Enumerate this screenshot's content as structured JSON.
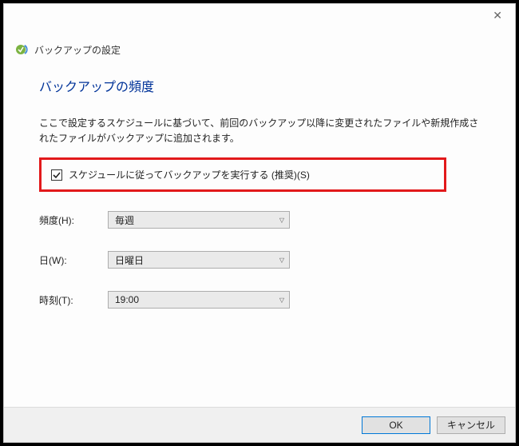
{
  "window": {
    "title": "バックアップの設定"
  },
  "heading": "バックアップの頻度",
  "description": "ここで設定するスケジュールに基づいて、前回のバックアップ以降に変更されたファイルや新規作成されたファイルがバックアップに追加されます。",
  "checkbox": {
    "checked": true,
    "label": "スケジュールに従ってバックアップを実行する (推奨)(S)"
  },
  "fields": {
    "frequency": {
      "label": "頻度(H):",
      "value": "毎週"
    },
    "day": {
      "label": "日(W):",
      "value": "日曜日"
    },
    "time": {
      "label": "時刻(T):",
      "value": "19:00"
    }
  },
  "buttons": {
    "ok": "OK",
    "cancel": "キャンセル"
  }
}
